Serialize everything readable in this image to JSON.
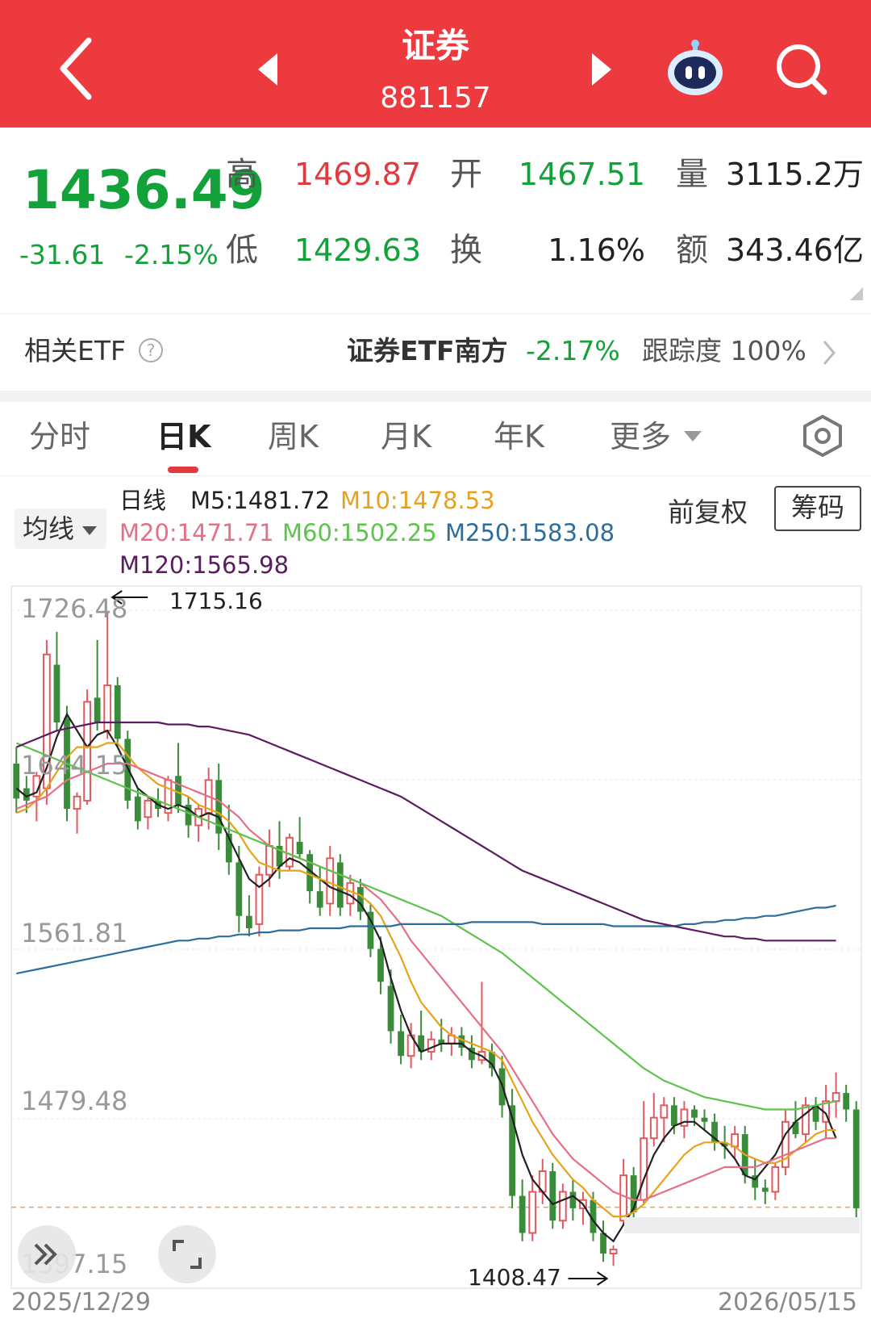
{
  "header": {
    "title": "证券",
    "code": "881157"
  },
  "quote": {
    "price": "1436.49",
    "change": "-31.61",
    "change_pct": "-2.15%",
    "high_label": "高",
    "high": "1469.87",
    "low_label": "低",
    "low": "1429.63",
    "open_label": "开",
    "open": "1467.51",
    "turnover_label": "换",
    "turnover": "1.16%",
    "volume_label": "量",
    "volume": "3115.2万",
    "amount_label": "额",
    "amount": "343.46亿"
  },
  "etf": {
    "label": "相关ETF",
    "help": "?",
    "name": "证券ETF南方",
    "pct": "-2.17%",
    "tracking": "跟踪度 100%"
  },
  "tabs": [
    {
      "label": "分时",
      "active": false
    },
    {
      "label": "日K",
      "active": true
    },
    {
      "label": "周K",
      "active": false
    },
    {
      "label": "月K",
      "active": false
    },
    {
      "label": "年K",
      "active": false
    },
    {
      "label": "更多",
      "active": false
    }
  ],
  "ma_legend": {
    "button": "均线",
    "period": "日线",
    "items": [
      {
        "text": "M5:1481.72",
        "color": "#222222"
      },
      {
        "text": "M10:1478.53",
        "color": "#e8a21a"
      },
      {
        "text": "M20:1471.71",
        "color": "#e56f86"
      },
      {
        "text": "M60:1502.25",
        "color": "#5cc44b"
      },
      {
        "text": "M250:1583.08",
        "color": "#2b6d9c"
      },
      {
        "text": "M120:1565.98",
        "color": "#5a1d5e"
      }
    ],
    "adjust": "前复权",
    "chips": "筹码"
  },
  "chart_data": {
    "type": "candlestick",
    "period": "日线",
    "y_ticks": [
      "1726.48",
      "1644.15",
      "1561.81",
      "1479.48",
      "1397.15"
    ],
    "ylim": [
      1397.15,
      1726.48
    ],
    "x_labels": [
      "2025/12/29",
      "2026/05/15"
    ],
    "max_annotation": "1715.16",
    "min_annotation": "1408.47",
    "last_close": 1436.49,
    "colors": {
      "up": "#e05a5f",
      "down": "#3a8c3a"
    },
    "candles": [
      {
        "o": 1652,
        "h": 1660,
        "l": 1628,
        "c": 1635
      },
      {
        "o": 1640,
        "h": 1646,
        "l": 1628,
        "c": 1634
      },
      {
        "o": 1636,
        "h": 1648,
        "l": 1624,
        "c": 1646
      },
      {
        "o": 1640,
        "h": 1712,
        "l": 1632,
        "c": 1705
      },
      {
        "o": 1700,
        "h": 1716,
        "l": 1668,
        "c": 1672
      },
      {
        "o": 1674,
        "h": 1680,
        "l": 1624,
        "c": 1630
      },
      {
        "o": 1630,
        "h": 1638,
        "l": 1618,
        "c": 1636
      },
      {
        "o": 1634,
        "h": 1688,
        "l": 1632,
        "c": 1682
      },
      {
        "o": 1684,
        "h": 1712,
        "l": 1668,
        "c": 1672
      },
      {
        "o": 1668,
        "h": 1726,
        "l": 1664,
        "c": 1690
      },
      {
        "o": 1690,
        "h": 1694,
        "l": 1660,
        "c": 1664
      },
      {
        "o": 1664,
        "h": 1668,
        "l": 1630,
        "c": 1634
      },
      {
        "o": 1636,
        "h": 1640,
        "l": 1620,
        "c": 1624
      },
      {
        "o": 1626,
        "h": 1636,
        "l": 1620,
        "c": 1634
      },
      {
        "o": 1634,
        "h": 1640,
        "l": 1626,
        "c": 1630
      },
      {
        "o": 1628,
        "h": 1646,
        "l": 1624,
        "c": 1644
      },
      {
        "o": 1646,
        "h": 1662,
        "l": 1628,
        "c": 1632
      },
      {
        "o": 1632,
        "h": 1636,
        "l": 1616,
        "c": 1622
      },
      {
        "o": 1622,
        "h": 1632,
        "l": 1614,
        "c": 1630
      },
      {
        "o": 1628,
        "h": 1650,
        "l": 1620,
        "c": 1644
      },
      {
        "o": 1644,
        "h": 1652,
        "l": 1610,
        "c": 1618
      },
      {
        "o": 1618,
        "h": 1632,
        "l": 1598,
        "c": 1604
      },
      {
        "o": 1604,
        "h": 1612,
        "l": 1570,
        "c": 1578
      },
      {
        "o": 1578,
        "h": 1588,
        "l": 1568,
        "c": 1572
      },
      {
        "o": 1574,
        "h": 1602,
        "l": 1568,
        "c": 1598
      },
      {
        "o": 1598,
        "h": 1620,
        "l": 1592,
        "c": 1612
      },
      {
        "o": 1612,
        "h": 1624,
        "l": 1596,
        "c": 1602
      },
      {
        "o": 1602,
        "h": 1618,
        "l": 1600,
        "c": 1616
      },
      {
        "o": 1614,
        "h": 1626,
        "l": 1606,
        "c": 1608
      },
      {
        "o": 1608,
        "h": 1610,
        "l": 1584,
        "c": 1590
      },
      {
        "o": 1590,
        "h": 1602,
        "l": 1578,
        "c": 1582
      },
      {
        "o": 1584,
        "h": 1612,
        "l": 1578,
        "c": 1606
      },
      {
        "o": 1604,
        "h": 1608,
        "l": 1578,
        "c": 1582
      },
      {
        "o": 1584,
        "h": 1598,
        "l": 1578,
        "c": 1594
      },
      {
        "o": 1592,
        "h": 1596,
        "l": 1576,
        "c": 1580
      },
      {
        "o": 1580,
        "h": 1584,
        "l": 1558,
        "c": 1562
      },
      {
        "o": 1562,
        "h": 1568,
        "l": 1540,
        "c": 1546
      },
      {
        "o": 1544,
        "h": 1552,
        "l": 1516,
        "c": 1522
      },
      {
        "o": 1522,
        "h": 1530,
        "l": 1506,
        "c": 1510
      },
      {
        "o": 1510,
        "h": 1526,
        "l": 1504,
        "c": 1520
      },
      {
        "o": 1520,
        "h": 1532,
        "l": 1508,
        "c": 1512
      },
      {
        "o": 1512,
        "h": 1522,
        "l": 1508,
        "c": 1518
      },
      {
        "o": 1518,
        "h": 1528,
        "l": 1512,
        "c": 1516
      },
      {
        "o": 1516,
        "h": 1524,
        "l": 1510,
        "c": 1520
      },
      {
        "o": 1520,
        "h": 1524,
        "l": 1510,
        "c": 1514
      },
      {
        "o": 1514,
        "h": 1520,
        "l": 1504,
        "c": 1508
      },
      {
        "o": 1508,
        "h": 1546,
        "l": 1506,
        "c": 1512
      },
      {
        "o": 1512,
        "h": 1516,
        "l": 1500,
        "c": 1504
      },
      {
        "o": 1504,
        "h": 1510,
        "l": 1480,
        "c": 1486
      },
      {
        "o": 1486,
        "h": 1494,
        "l": 1436,
        "c": 1442
      },
      {
        "o": 1442,
        "h": 1450,
        "l": 1420,
        "c": 1424
      },
      {
        "o": 1424,
        "h": 1452,
        "l": 1420,
        "c": 1444
      },
      {
        "o": 1444,
        "h": 1460,
        "l": 1438,
        "c": 1454
      },
      {
        "o": 1454,
        "h": 1458,
        "l": 1426,
        "c": 1430
      },
      {
        "o": 1430,
        "h": 1448,
        "l": 1426,
        "c": 1444
      },
      {
        "o": 1444,
        "h": 1450,
        "l": 1430,
        "c": 1436
      },
      {
        "o": 1436,
        "h": 1444,
        "l": 1428,
        "c": 1440
      },
      {
        "o": 1440,
        "h": 1444,
        "l": 1420,
        "c": 1424
      },
      {
        "o": 1424,
        "h": 1430,
        "l": 1410,
        "c": 1414
      },
      {
        "o": 1414,
        "h": 1418,
        "l": 1408,
        "c": 1416
      },
      {
        "o": 1430,
        "h": 1460,
        "l": 1428,
        "c": 1452
      },
      {
        "o": 1452,
        "h": 1456,
        "l": 1430,
        "c": 1434
      },
      {
        "o": 1440,
        "h": 1488,
        "l": 1438,
        "c": 1470
      },
      {
        "o": 1470,
        "h": 1492,
        "l": 1466,
        "c": 1480
      },
      {
        "o": 1480,
        "h": 1490,
        "l": 1468,
        "c": 1486
      },
      {
        "o": 1486,
        "h": 1490,
        "l": 1472,
        "c": 1476
      },
      {
        "o": 1476,
        "h": 1488,
        "l": 1470,
        "c": 1484
      },
      {
        "o": 1484,
        "h": 1486,
        "l": 1476,
        "c": 1480
      },
      {
        "o": 1480,
        "h": 1484,
        "l": 1474,
        "c": 1478
      },
      {
        "o": 1478,
        "h": 1482,
        "l": 1464,
        "c": 1468
      },
      {
        "o": 1468,
        "h": 1476,
        "l": 1460,
        "c": 1466
      },
      {
        "o": 1466,
        "h": 1476,
        "l": 1460,
        "c": 1472
      },
      {
        "o": 1472,
        "h": 1476,
        "l": 1448,
        "c": 1452
      },
      {
        "o": 1452,
        "h": 1460,
        "l": 1440,
        "c": 1446
      },
      {
        "o": 1446,
        "h": 1450,
        "l": 1438,
        "c": 1444
      },
      {
        "o": 1444,
        "h": 1458,
        "l": 1440,
        "c": 1456
      },
      {
        "o": 1456,
        "h": 1484,
        "l": 1452,
        "c": 1478
      },
      {
        "o": 1478,
        "h": 1488,
        "l": 1470,
        "c": 1472
      },
      {
        "o": 1472,
        "h": 1490,
        "l": 1468,
        "c": 1486
      },
      {
        "o": 1486,
        "h": 1490,
        "l": 1474,
        "c": 1478
      },
      {
        "o": 1478,
        "h": 1496,
        "l": 1470,
        "c": 1488
      },
      {
        "o": 1488,
        "h": 1502,
        "l": 1480,
        "c": 1492
      },
      {
        "o": 1492,
        "h": 1496,
        "l": 1478,
        "c": 1484
      },
      {
        "o": 1484,
        "h": 1488,
        "l": 1430,
        "c": 1436
      }
    ],
    "ma_series": [
      {
        "name": "M5",
        "color": "#222222",
        "values": [
          1640,
          1636,
          1638,
          1650,
          1665,
          1676,
          1668,
          1660,
          1666,
          1668,
          1660,
          1650,
          1640,
          1636,
          1632,
          1630,
          1632,
          1630,
          1626,
          1628,
          1626,
          1616,
          1606,
          1596,
          1592,
          1596,
          1602,
          1606,
          1604,
          1600,
          1596,
          1592,
          1590,
          1588,
          1584,
          1576,
          1566,
          1548,
          1532,
          1520,
          1512,
          1514,
          1516,
          1516,
          1516,
          1512,
          1510,
          1506,
          1496,
          1480,
          1462,
          1450,
          1444,
          1438,
          1440,
          1442,
          1438,
          1430,
          1424,
          1420,
          1428,
          1436,
          1450,
          1462,
          1470,
          1476,
          1478,
          1478,
          1474,
          1470,
          1466,
          1460,
          1452,
          1450,
          1456,
          1462,
          1472,
          1478,
          1482,
          1486,
          1482,
          1470
        ]
      },
      {
        "name": "M10",
        "color": "#e8a21a",
        "values": [
          1628,
          1630,
          1634,
          1640,
          1648,
          1655,
          1660,
          1660,
          1660,
          1662,
          1662,
          1656,
          1650,
          1646,
          1642,
          1640,
          1638,
          1636,
          1632,
          1630,
          1628,
          1624,
          1618,
          1610,
          1604,
          1602,
          1600,
          1600,
          1600,
          1598,
          1596,
          1594,
          1592,
          1590,
          1588,
          1584,
          1578,
          1568,
          1558,
          1546,
          1536,
          1530,
          1524,
          1520,
          1518,
          1516,
          1514,
          1512,
          1508,
          1498,
          1488,
          1478,
          1470,
          1462,
          1456,
          1450,
          1446,
          1440,
          1436,
          1432,
          1432,
          1434,
          1438,
          1444,
          1450,
          1456,
          1462,
          1466,
          1468,
          1468,
          1468,
          1466,
          1462,
          1460,
          1458,
          1458,
          1460,
          1464,
          1468,
          1472,
          1474,
          1474
        ]
      },
      {
        "name": "M20",
        "color": "#e56f86",
        "values": [
          1630,
          1632,
          1634,
          1636,
          1640,
          1644,
          1646,
          1648,
          1650,
          1652,
          1652,
          1652,
          1650,
          1648,
          1646,
          1644,
          1642,
          1640,
          1638,
          1636,
          1634,
          1630,
          1626,
          1620,
          1616,
          1612,
          1610,
          1608,
          1606,
          1604,
          1602,
          1600,
          1598,
          1596,
          1594,
          1590,
          1586,
          1580,
          1574,
          1566,
          1560,
          1554,
          1548,
          1542,
          1536,
          1530,
          1524,
          1518,
          1512,
          1504,
          1496,
          1488,
          1480,
          1472,
          1466,
          1460,
          1456,
          1452,
          1448,
          1444,
          1442,
          1440,
          1440,
          1442,
          1444,
          1446,
          1448,
          1450,
          1452,
          1454,
          1456,
          1456,
          1456,
          1456,
          1458,
          1460,
          1462,
          1464,
          1466,
          1468,
          1470,
          1470
        ]
      },
      {
        "name": "M60",
        "color": "#5cc44b",
        "values": [
          1662,
          1660,
          1658,
          1656,
          1654,
          1652,
          1650,
          1648,
          1646,
          1644,
          1642,
          1640,
          1638,
          1636,
          1634,
          1632,
          1630,
          1628,
          1626,
          1624,
          1622,
          1620,
          1618,
          1616,
          1614,
          1612,
          1610,
          1608,
          1606,
          1604,
          1602,
          1600,
          1598,
          1596,
          1594,
          1592,
          1590,
          1588,
          1586,
          1584,
          1582,
          1580,
          1578,
          1575,
          1572,
          1569,
          1566,
          1563,
          1560,
          1556,
          1552,
          1548,
          1544,
          1540,
          1536,
          1532,
          1528,
          1524,
          1520,
          1516,
          1512,
          1508,
          1504,
          1501,
          1498,
          1496,
          1494,
          1492,
          1490,
          1489,
          1488,
          1487,
          1486,
          1485,
          1484,
          1484,
          1484,
          1484,
          1485,
          1486,
          1487,
          1488
        ]
      },
      {
        "name": "M250",
        "color": "#2b6d9c",
        "values": [
          1550,
          1551,
          1552,
          1553,
          1554,
          1555,
          1556,
          1557,
          1558,
          1559,
          1560,
          1561,
          1562,
          1563,
          1564,
          1565,
          1566,
          1566,
          1567,
          1567,
          1568,
          1568,
          1569,
          1569,
          1570,
          1570,
          1571,
          1571,
          1571,
          1572,
          1572,
          1572,
          1572,
          1573,
          1573,
          1573,
          1573,
          1573,
          1574,
          1574,
          1574,
          1574,
          1574,
          1574,
          1574,
          1575,
          1575,
          1575,
          1575,
          1575,
          1575,
          1575,
          1574,
          1574,
          1574,
          1574,
          1574,
          1574,
          1574,
          1573,
          1573,
          1573,
          1573,
          1573,
          1573,
          1573,
          1574,
          1574,
          1575,
          1575,
          1576,
          1576,
          1577,
          1577,
          1578,
          1578,
          1579,
          1580,
          1581,
          1582,
          1582,
          1583
        ]
      },
      {
        "name": "M120",
        "color": "#5a1d5e",
        "values": [
          1660,
          1662,
          1664,
          1666,
          1668,
          1669,
          1670,
          1671,
          1672,
          1672,
          1672,
          1672,
          1672,
          1672,
          1672,
          1671,
          1671,
          1671,
          1670,
          1670,
          1669,
          1668,
          1667,
          1666,
          1664,
          1662,
          1660,
          1658,
          1656,
          1654,
          1652,
          1650,
          1648,
          1646,
          1644,
          1642,
          1640,
          1638,
          1636,
          1633,
          1630,
          1627,
          1624,
          1621,
          1618,
          1615,
          1612,
          1609,
          1606,
          1603,
          1600,
          1598,
          1596,
          1594,
          1592,
          1590,
          1588,
          1586,
          1584,
          1582,
          1580,
          1578,
          1576,
          1575,
          1574,
          1573,
          1572,
          1571,
          1570,
          1569,
          1568,
          1568,
          1567,
          1567,
          1566,
          1566,
          1566,
          1566,
          1566,
          1566,
          1566,
          1566
        ]
      }
    ]
  }
}
